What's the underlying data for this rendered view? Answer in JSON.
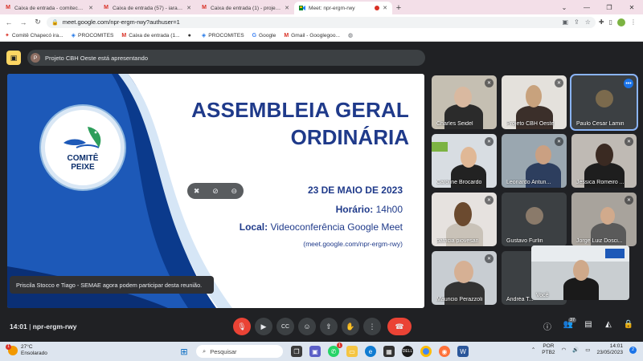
{
  "browser": {
    "tabs": [
      {
        "label": "Caixa de entrada - comitechapec",
        "icon": "gmail-icon",
        "active": false
      },
      {
        "label": "Caixa de entrada (57) - iaravezal",
        "icon": "gmail-icon",
        "active": false
      },
      {
        "label": "Caixa de entrada (1) - projeto.cb",
        "icon": "gmail-icon",
        "active": false
      },
      {
        "label": "Meet: npr-ergm-rwy",
        "icon": "meet-icon",
        "active": true
      }
    ],
    "new_tab_label": "+",
    "url": "meet.google.com/npr-ergm-rwy?authuser=1",
    "bookmarks": [
      {
        "label": "Comitê Chapecó ira...",
        "icon": "bookmark-red-icon"
      },
      {
        "label": "PROCOMITES",
        "icon": "procomites-icon"
      },
      {
        "label": "Caixa de entrada (1...",
        "icon": "gmail-icon"
      },
      {
        "label": "",
        "icon": "github-icon"
      },
      {
        "label": "PROCOMITES",
        "icon": "procomites-icon"
      },
      {
        "label": "Google",
        "icon": "google-icon"
      },
      {
        "label": "Gmail - Googlegoo...",
        "icon": "gmail-icon"
      },
      {
        "label": "",
        "icon": "globe-icon"
      }
    ]
  },
  "meet": {
    "presenter_text": "Projeto CBH Oeste está apresentando",
    "presenter_initial": "P",
    "slide": {
      "logo_line1": "COMITÊ",
      "logo_line2": "PEIXE",
      "title_line1": "ASSEMBLEIA GERAL",
      "title_line2": "ORDINÁRIA",
      "date": "23 DE MAIO DE 2023",
      "time_label": "Horário:",
      "time_value": " 14h00",
      "location_label": "Local:",
      "location_value": " Videoconferência Google Meet",
      "url": "(meet.google.com/npr-ergm-rwy)"
    },
    "toast": "Priscila Stocco e Tiago - SEMAE agora podem participar desta reunião.",
    "participants": [
      {
        "name": "Charles Seidel"
      },
      {
        "name": "Projeto CBH Oeste"
      },
      {
        "name": "Paulo Cesar Lamin"
      },
      {
        "name": "Caroline Brocardo"
      },
      {
        "name": "Leonardo Antun..."
      },
      {
        "name": "Jessica Romeiro ..."
      },
      {
        "name": "patricia piovesan"
      },
      {
        "name": "Gustavo Furlin"
      },
      {
        "name": "Jorge Luiz Dosci..."
      },
      {
        "name": "Mauricio Perazzoli"
      },
      {
        "name": "Andréa T..."
      },
      {
        "name": "Você"
      }
    ],
    "time": "14:01",
    "meeting_code": "npr-ergm-rwy",
    "participant_count": "37"
  },
  "taskbar": {
    "weather_temp": "27°C",
    "weather_desc": "Ensolarado",
    "weather_badge": "1",
    "search_placeholder": "Pesquisar",
    "lang_line1": "POR",
    "lang_line2": "PTB2",
    "clock_time": "14:01",
    "clock_date": "23/05/2023",
    "notification_count": "2",
    "whatsapp_badge": "1"
  }
}
